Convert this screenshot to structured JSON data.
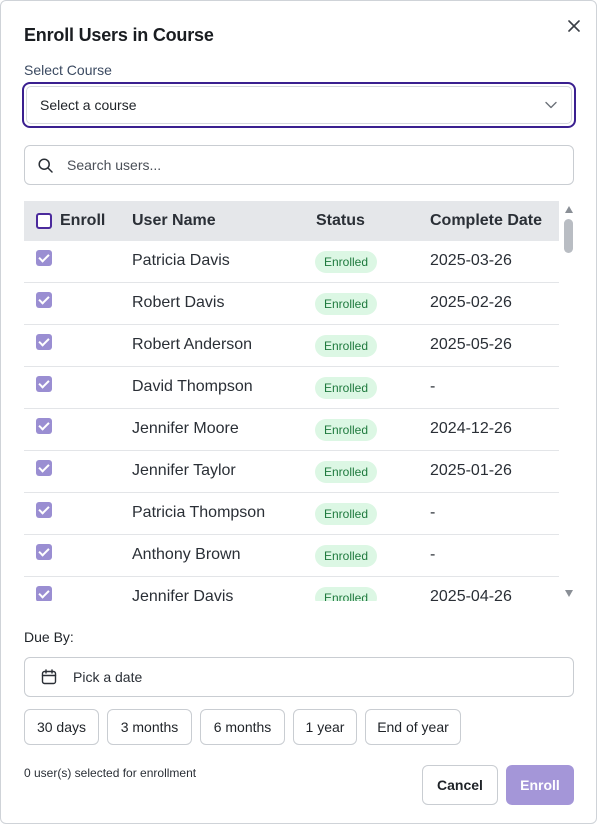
{
  "dialog": {
    "title": "Enroll Users in Course",
    "close_icon": "close-icon"
  },
  "course": {
    "label": "Select Course",
    "value": "Select a course",
    "chevron_icon": "chevron-down-icon"
  },
  "search": {
    "placeholder": "Search users...",
    "value": "",
    "icon": "search-icon"
  },
  "table": {
    "headers": {
      "enroll": "Enroll",
      "user_name": "User Name",
      "status": "Status",
      "complete_date": "Complete Date"
    },
    "select_all_checked": false,
    "rows": [
      {
        "name": "Patricia Davis",
        "status": "Enrolled",
        "date": "2025-03-26",
        "checked": true
      },
      {
        "name": "Robert Davis",
        "status": "Enrolled",
        "date": "2025-02-26",
        "checked": true
      },
      {
        "name": "Robert Anderson",
        "status": "Enrolled",
        "date": "2025-05-26",
        "checked": true
      },
      {
        "name": "David Thompson",
        "status": "Enrolled",
        "date": "-",
        "checked": true
      },
      {
        "name": "Jennifer Moore",
        "status": "Enrolled",
        "date": "2024-12-26",
        "checked": true
      },
      {
        "name": "Jennifer Taylor",
        "status": "Enrolled",
        "date": "2025-01-26",
        "checked": true
      },
      {
        "name": "Patricia Thompson",
        "status": "Enrolled",
        "date": "-",
        "checked": true
      },
      {
        "name": "Anthony Brown",
        "status": "Enrolled",
        "date": "-",
        "checked": true
      },
      {
        "name": "Jennifer Davis",
        "status": "Enrolled",
        "date": "2025-04-26",
        "checked": true
      }
    ]
  },
  "due": {
    "label": "Due By:",
    "placeholder": "Pick a date",
    "calendar_icon": "calendar-icon",
    "presets": [
      "30 days",
      "3 months",
      "6 months",
      "1 year",
      "End of year"
    ]
  },
  "footer": {
    "selected_text": "0 user(s) selected for enrollment",
    "cancel_label": "Cancel",
    "enroll_label": "Enroll"
  },
  "colors": {
    "accent": "#3a1f8f",
    "enroll_button": "#a496d8",
    "status_bg": "#dcf7e4",
    "status_text": "#1f7a3e",
    "header_bg": "#e5e7ea"
  }
}
